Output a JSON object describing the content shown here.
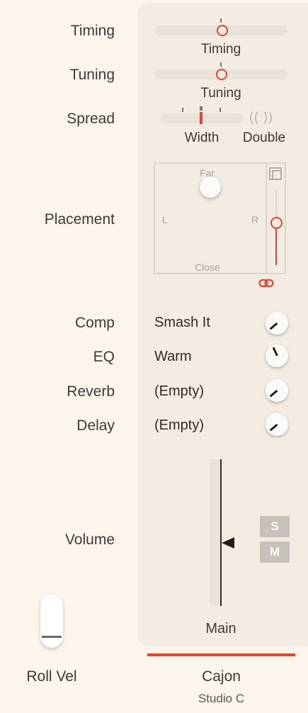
{
  "rows": {
    "timing": {
      "label": "Timing",
      "slider_label": "Timing"
    },
    "tuning": {
      "label": "Tuning",
      "slider_label": "Tuning"
    },
    "spread": {
      "label": "Spread",
      "width_label": "Width",
      "double_label": "Double",
      "double_icon": "(( ))"
    },
    "placement": {
      "label": "Placement",
      "far": "Far",
      "close": "Close",
      "left": "L",
      "right": "R"
    },
    "fx": [
      {
        "label": "Comp",
        "value": "Smash It"
      },
      {
        "label": "EQ",
        "value": "Warm"
      },
      {
        "label": "Reverb",
        "value": "(Empty)"
      },
      {
        "label": "Delay",
        "value": "(Empty)"
      }
    ],
    "volume": {
      "label": "Volume",
      "solo": "S",
      "mute": "M",
      "output": "Main"
    }
  },
  "roll_vel": {
    "label": "Roll Vel"
  },
  "instrument": {
    "name": "Cajon",
    "room": "Studio C"
  },
  "colors": {
    "accent": "#e8452c",
    "background": "#fcf5eb",
    "panel": "#f3ece2"
  },
  "icons": {
    "expand": "expand-icon",
    "link": "link-icon",
    "double": "double-icon"
  }
}
